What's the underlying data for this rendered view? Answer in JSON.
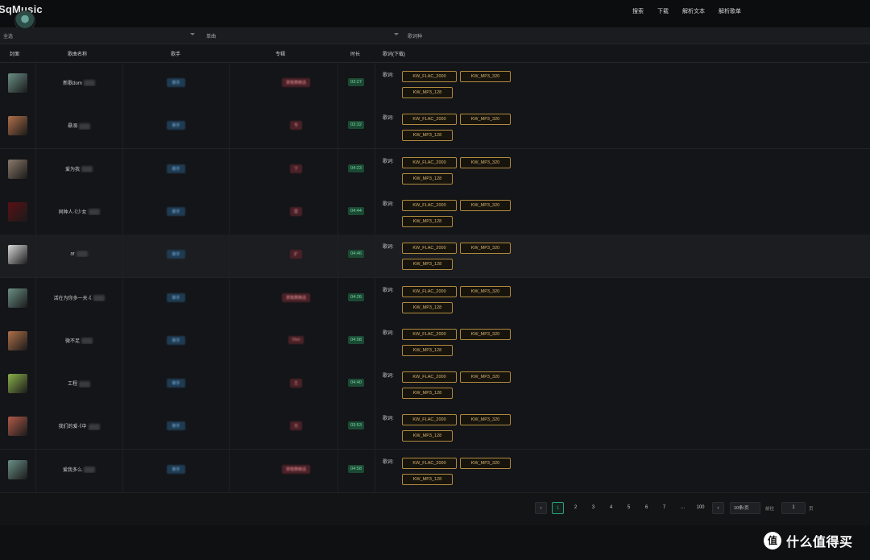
{
  "app": {
    "brand": "SqMusic"
  },
  "nav": [
    "搜索",
    "下载",
    "解析文本",
    "解析歌单"
  ],
  "filters": {
    "select_all": "全选",
    "col2": "单曲",
    "col3": "歌词种"
  },
  "columns": [
    "封面",
    "歌曲名称",
    "歌手",
    "专辑",
    "时长",
    "歌词(下载)"
  ],
  "rows": [
    {
      "song": "新歌dom",
      "artist": "歌手",
      "album": "萧敬腾精选",
      "duration": "03:27",
      "lyrics": "歌词:",
      "cover": "#6a8f85",
      "highlight": false
    },
    {
      "song": "悬溺",
      "artist": "歌手",
      "album": "专",
      "duration": "03:32",
      "lyrics": "歌词:",
      "cover": "#b0704a",
      "highlight": false
    },
    {
      "song": "爱为我",
      "artist": "歌手",
      "album": "下",
      "duration": "04:23",
      "lyrics": "歌词:",
      "cover": "#8b7a6a",
      "highlight": false
    },
    {
      "song": "同种人·《少女",
      "artist": "歌手",
      "album": "雷",
      "duration": "04:44",
      "lyrics": "歌词:",
      "cover": "#5a1014",
      "highlight": false
    },
    {
      "song": "ar",
      "artist": "歌手",
      "album": "扩",
      "duration": "04:46",
      "lyrics": "歌词:",
      "cover": "#d8d8d8",
      "highlight": true
    },
    {
      "song": "活在为你多一天·《",
      "artist": "歌手",
      "album": "萧敬腾精选",
      "duration": "04:26",
      "lyrics": "歌词:",
      "cover": "#6a8f85",
      "highlight": false
    },
    {
      "song": "微不足",
      "artist": "歌手",
      "album": "Vivo",
      "duration": "04:08",
      "lyrics": "歌词:",
      "cover": "#b0704a",
      "highlight": false
    },
    {
      "song": "工程",
      "artist": "歌手",
      "album": "王",
      "duration": "04:40",
      "lyrics": "歌词:",
      "cover": "#8bb04a",
      "highlight": false
    },
    {
      "song": "我们的爱·《中",
      "artist": "歌手",
      "album": "光",
      "duration": "03:53",
      "lyrics": "歌词:",
      "cover": "#b05a4a",
      "highlight": false
    },
    {
      "song": "爱我多么",
      "artist": "歌手",
      "album": "萧敬腾精选",
      "duration": "04:58",
      "lyrics": "歌词:",
      "cover": "#6a8f85",
      "highlight": false
    }
  ],
  "download_buttons": [
    "KW_FLAC_2000",
    "KW_MP3_320",
    "KW_MP3_128"
  ],
  "pagination": {
    "prev": "‹",
    "next": "›",
    "pages": [
      "1",
      "2",
      "3",
      "4",
      "5",
      "6",
      "7",
      "...",
      "100"
    ],
    "active": "1",
    "page_size": "10条/页",
    "goto_label": "前往",
    "goto_value": "1",
    "page_suffix": "页"
  },
  "watermark": {
    "logo": "值",
    "text": "什么值得买"
  }
}
